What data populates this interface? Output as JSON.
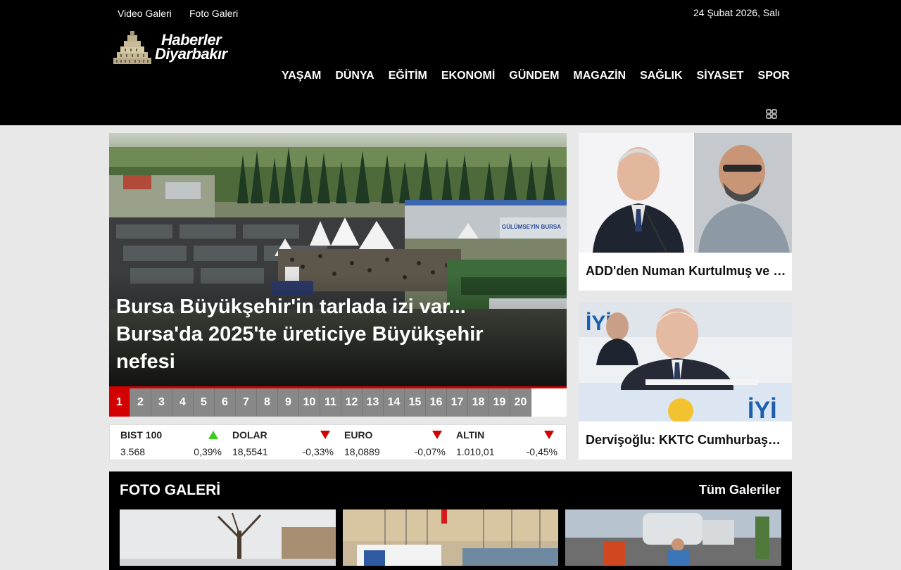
{
  "topbar": {
    "links": [
      "Video Galeri",
      "Foto Galeri"
    ],
    "date": "24 Şubat 2026, Salı"
  },
  "logo": {
    "line1": "Haberler",
    "line2": "Diyarbakır"
  },
  "nav": [
    "YAŞAM",
    "DÜNYA",
    "EĞİTİM",
    "EKONOMİ",
    "GÜNDEM",
    "MAGAZİN",
    "SAĞLIK",
    "SİYASET",
    "SPOR"
  ],
  "menu_icon": "grid-icon",
  "hero": {
    "title": "Bursa Büyükşehir'in tarlada izi var... Bursa'da 2025'te üreticiye Büyükşehir nefesi",
    "sign_text": "GÜLÜMSEYİN BURSA"
  },
  "pager": [
    "1",
    "2",
    "3",
    "4",
    "5",
    "6",
    "7",
    "8",
    "9",
    "10",
    "11",
    "12",
    "13",
    "14",
    "15",
    "16",
    "17",
    "18",
    "19",
    "20"
  ],
  "pager_active": 1,
  "market": [
    {
      "name": "BIST 100",
      "value": "3.568",
      "pct": "0,39%",
      "dir": "up"
    },
    {
      "name": "DOLAR",
      "value": "18,5541",
      "pct": "-0,33%",
      "dir": "down"
    },
    {
      "name": "EURO",
      "value": "18,0889",
      "pct": "-0,07%",
      "dir": "down"
    },
    {
      "name": "ALTIN",
      "value": "1.010,01",
      "pct": "-0,45%",
      "dir": "down"
    }
  ],
  "side_cards": [
    {
      "title": "ADD'den Numan Kurtulmuş ve Sırrı Sakık'a tepki"
    },
    {
      "title": "Dervişoğlu: KKTC Cumhurbaşkanı seçimi"
    }
  ],
  "side_card2_brand": "İYİ",
  "gallery": {
    "title": "FOTO GALERİ",
    "all_link": "Tüm Galeriler"
  },
  "colors": {
    "accent": "#d20000",
    "header": "#000000",
    "up": "#3dcb1e",
    "down": "#d20000"
  }
}
